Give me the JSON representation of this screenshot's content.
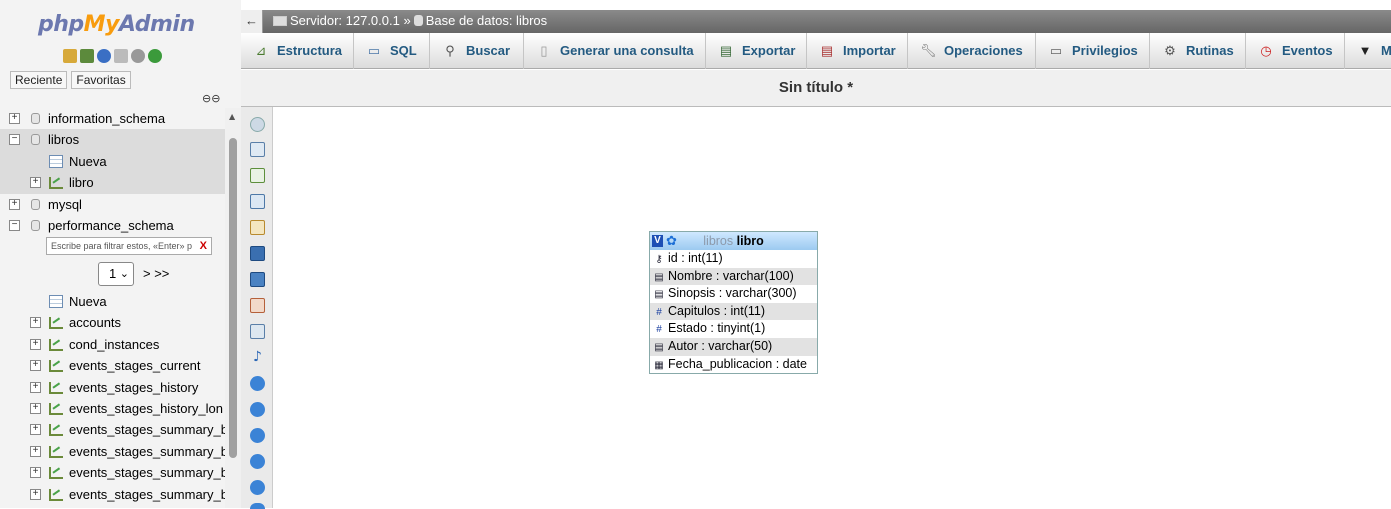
{
  "app": {
    "logo": {
      "php": "php",
      "my": "My",
      "admin": "Admin"
    },
    "nav_tabs": [
      "Reciente",
      "Favoritas"
    ]
  },
  "tree": [
    {
      "name": "information_schema",
      "type": "db",
      "expander": "+",
      "level": 0
    },
    {
      "name": "libros",
      "type": "db",
      "expander": "−",
      "level": 0,
      "selected": true
    },
    {
      "name": "Nueva",
      "type": "new",
      "expander": "",
      "level": 1,
      "selected": true
    },
    {
      "name": "libro",
      "type": "table",
      "expander": "+",
      "level": 1,
      "selected": true
    },
    {
      "name": "mysql",
      "type": "db",
      "expander": "+",
      "level": 0
    },
    {
      "name": "performance_schema",
      "type": "db",
      "expander": "−",
      "level": 0
    }
  ],
  "filter": {
    "placeholder": "Escribe para filtrar estos, «Enter» p",
    "clear": "X"
  },
  "pager": {
    "page": "1",
    "next": "> >>"
  },
  "tree2": [
    {
      "name": "Nueva",
      "type": "new"
    },
    {
      "name": "accounts",
      "type": "table"
    },
    {
      "name": "cond_instances",
      "type": "table"
    },
    {
      "name": "events_stages_current",
      "type": "table"
    },
    {
      "name": "events_stages_history",
      "type": "table"
    },
    {
      "name": "events_stages_history_lon",
      "type": "table"
    },
    {
      "name": "events_stages_summary_b",
      "type": "table"
    },
    {
      "name": "events_stages_summary_b",
      "type": "table"
    },
    {
      "name": "events_stages_summary_b",
      "type": "table"
    },
    {
      "name": "events_stages_summary_b",
      "type": "table"
    }
  ],
  "breadcrumb": {
    "server_label": "Servidor: 127.0.0.1",
    "separator": "»",
    "db_label": "Base de datos: libros"
  },
  "menu": [
    {
      "label": "Estructura",
      "icon": "structure-icon"
    },
    {
      "label": "SQL",
      "icon": "sql-icon"
    },
    {
      "label": "Buscar",
      "icon": "search-icon"
    },
    {
      "label": "Generar una consulta",
      "icon": "query-icon"
    },
    {
      "label": "Exportar",
      "icon": "export-icon"
    },
    {
      "label": "Importar",
      "icon": "import-icon"
    },
    {
      "label": "Operaciones",
      "icon": "wrench-icon"
    },
    {
      "label": "Privilegios",
      "icon": "privileges-icon"
    },
    {
      "label": "Rutinas",
      "icon": "routines-icon"
    },
    {
      "label": "Eventos",
      "icon": "events-icon"
    },
    {
      "label": "M",
      "icon": "chevron-down-icon"
    }
  ],
  "page_title": "Sin título *",
  "designer_table": {
    "db": "libros",
    "table": "libro",
    "columns": [
      {
        "text": "id : int(11)",
        "icon": "key-icon",
        "glyph": "⚷"
      },
      {
        "text": "Nombre : varchar(100)",
        "icon": "text-icon",
        "glyph": "▤"
      },
      {
        "text": "Sinopsis : varchar(300)",
        "icon": "text-icon",
        "glyph": "▤"
      },
      {
        "text": "Capitulos : int(11)",
        "icon": "number-icon",
        "glyph": "#"
      },
      {
        "text": "Estado : tinyint(1)",
        "icon": "number-icon",
        "glyph": "#"
      },
      {
        "text": "Autor : varchar(50)",
        "icon": "text-icon",
        "glyph": "▤"
      },
      {
        "text": "Fecha_publicacion : date",
        "icon": "calendar-icon",
        "glyph": "▦"
      }
    ]
  },
  "colors": {
    "menu_text": "#235a81",
    "topbar": "#777777",
    "header_bg": "#9ccaf0"
  }
}
